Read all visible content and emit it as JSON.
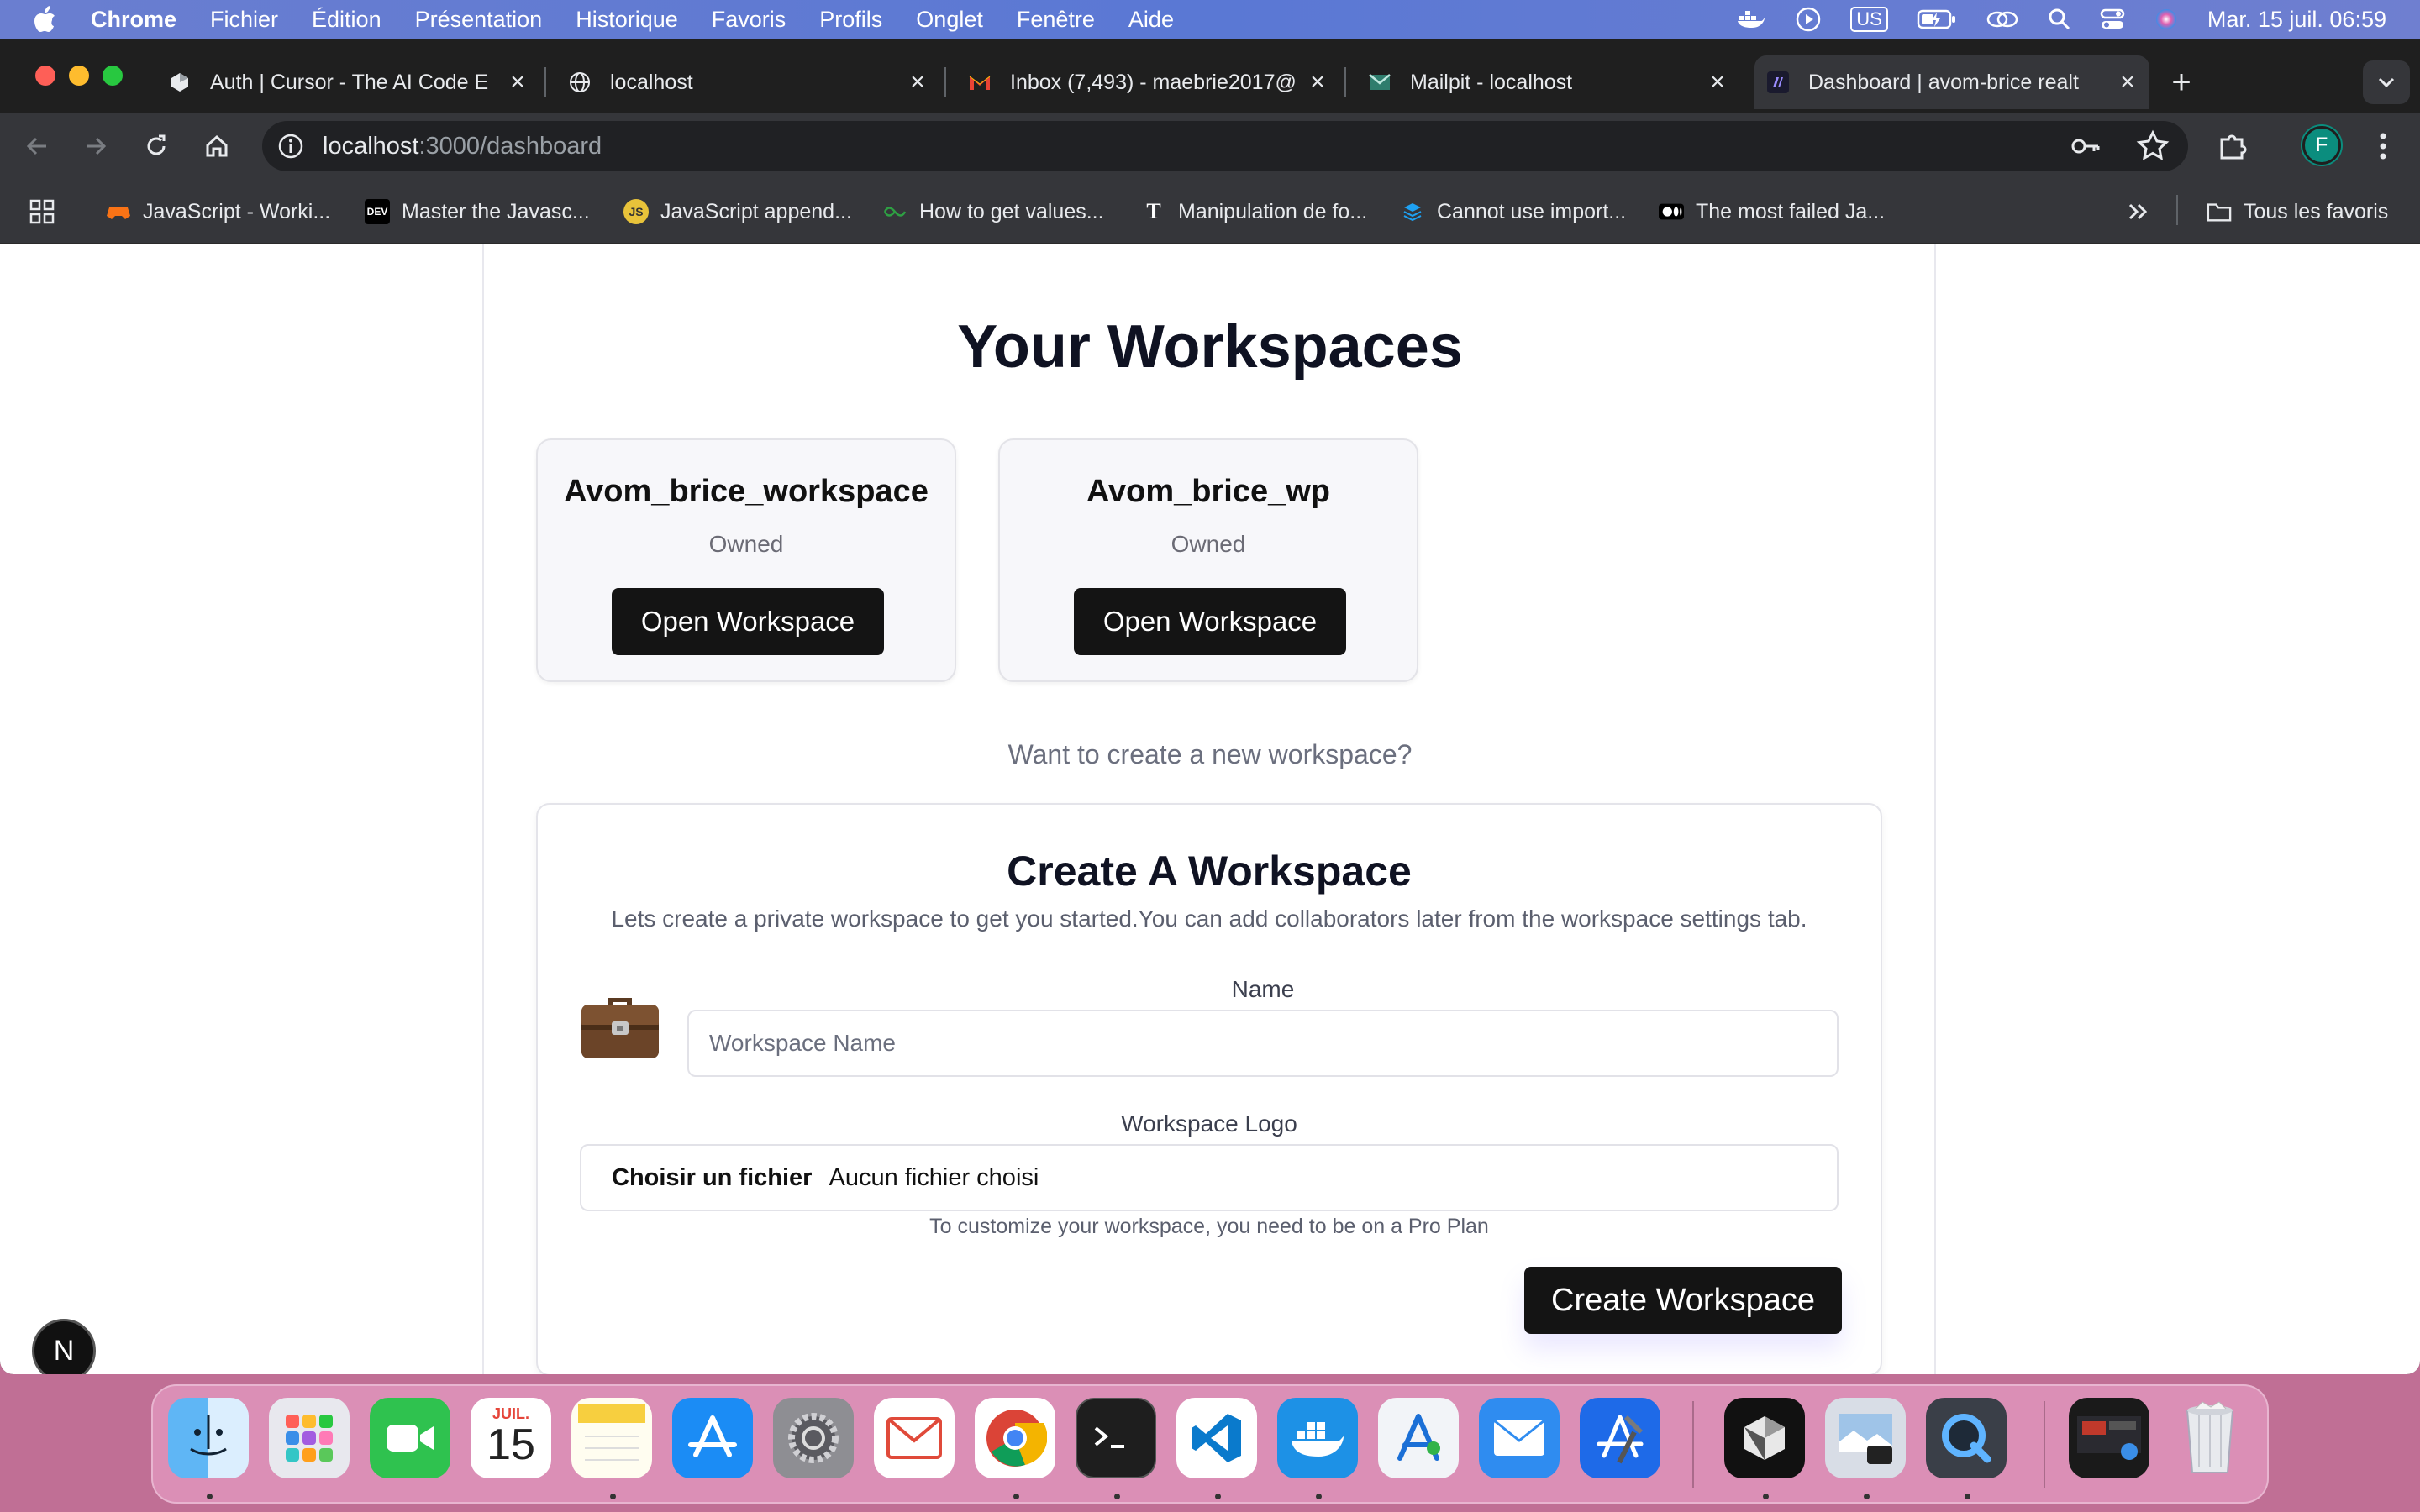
{
  "menubar": {
    "app_name": "Chrome",
    "items": [
      "Fichier",
      "Édition",
      "Présentation",
      "Historique",
      "Favoris",
      "Profils",
      "Onglet",
      "Fenêtre",
      "Aide"
    ],
    "keyboard": "US",
    "clock": "Mar. 15 juil.  06:59"
  },
  "tabs": [
    {
      "title": "Auth | Cursor - The AI Code E",
      "favicon": "cursor-icon"
    },
    {
      "title": "localhost",
      "favicon": "globe-icon"
    },
    {
      "title": "Inbox (7,493) - maebrie2017@",
      "favicon": "gmail-icon"
    },
    {
      "title": "Mailpit - localhost",
      "favicon": "mailpit-icon"
    },
    {
      "title": "Dashboard | avom-brice realt",
      "favicon": "app-icon",
      "active": true
    }
  ],
  "address": {
    "host": "localhost",
    "path": ":3000/dashboard"
  },
  "profile_initial": "F",
  "bookmarks": [
    {
      "label": "JavaScript - Worki...",
      "icon": "game-icon"
    },
    {
      "label": "Master the Javasc...",
      "icon": "dev-icon"
    },
    {
      "label": "JavaScript append...",
      "icon": "js-icon"
    },
    {
      "label": "How to get values...",
      "icon": "link-icon"
    },
    {
      "label": "Manipulation de fo...",
      "icon": "t-icon"
    },
    {
      "label": "Cannot use import...",
      "icon": "stack-icon"
    },
    {
      "label": "The most failed Ja...",
      "icon": "medium-icon"
    }
  ],
  "bookmarks_folder": "Tous les favoris",
  "page": {
    "title": "Your Workspaces",
    "workspaces": [
      {
        "name": "Avom_brice_workspace",
        "role": "Owned",
        "button": "Open Workspace"
      },
      {
        "name": "Avom_brice_wp",
        "role": "Owned",
        "button": "Open Workspace"
      }
    ],
    "prompt": "Want to create a new workspace?",
    "create": {
      "title": "Create A Workspace",
      "subtitle": "Lets create a private workspace to get you started.You can add collaborators later from the workspace settings tab.",
      "name_label": "Name",
      "name_placeholder": "Workspace Name",
      "logo_label": "Workspace Logo",
      "file_button": "Choisir un fichier",
      "file_status": "Aucun fichier choisi",
      "pro_note": "To customize your workspace, you need to be on a Pro Plan",
      "submit": "Create Workspace"
    },
    "dev_badge": "N"
  },
  "dock": {
    "calendar_month": "JUIL.",
    "calendar_day": "15",
    "apps": [
      "finder-icon",
      "launchpad-icon",
      "facetime-icon",
      "calendar-icon",
      "notes-icon",
      "app-store-icon",
      "system-settings-icon",
      "mail-alt-icon",
      "chrome-icon",
      "terminal-icon",
      "vscode-icon",
      "docker-icon",
      "instruments-icon",
      "mail-icon",
      "xcode-icon",
      "cursor-icon",
      "preview-icon",
      "quicktime-icon",
      "screenshot-icon",
      "trash-icon"
    ]
  }
}
